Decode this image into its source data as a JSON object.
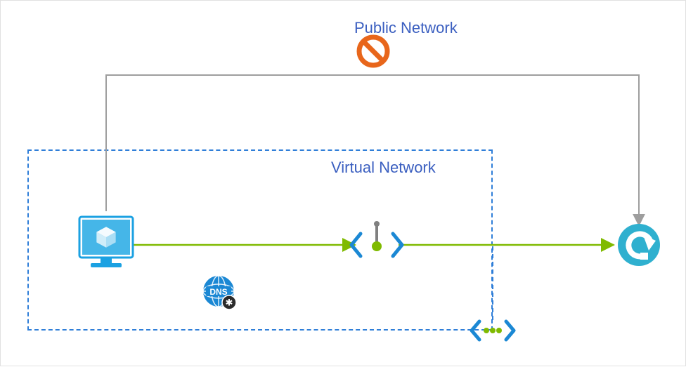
{
  "labels": {
    "public_network": "Public Network",
    "virtual_network": "Virtual Network"
  },
  "colors": {
    "accent_blue": "#1ba1e2",
    "deep_blue": "#3975b9",
    "green": "#7fba00",
    "orange": "#e8661b",
    "gray": "#9e9e9e",
    "text_blue": "#3b5fc0",
    "dark": "#333333"
  },
  "nodes": [
    {
      "id": "vm",
      "name": "virtual-machine",
      "type": "Virtual Machine"
    },
    {
      "id": "dns",
      "name": "private-dns-zone",
      "type": "Private DNS Zone"
    },
    {
      "id": "pe",
      "name": "private-endpoint",
      "type": "Private Endpoint"
    },
    {
      "id": "svc",
      "name": "relay-service",
      "type": "Azure Relay"
    },
    {
      "id": "nic",
      "name": "private-endpoint-nic",
      "type": "Network Interface (connected)"
    }
  ],
  "connections": [
    {
      "from": "vm",
      "to": "pe",
      "via": "virtual-network",
      "color": "green",
      "allowed": true
    },
    {
      "from": "pe",
      "to": "svc",
      "via": "virtual-network",
      "color": "green",
      "allowed": true
    },
    {
      "from": "vm",
      "to": "svc",
      "via": "public-network",
      "color": "gray",
      "allowed": false
    }
  ],
  "containers": {
    "virtual_network": {
      "contains": [
        "vm",
        "dns",
        "pe",
        "nic"
      ]
    }
  }
}
